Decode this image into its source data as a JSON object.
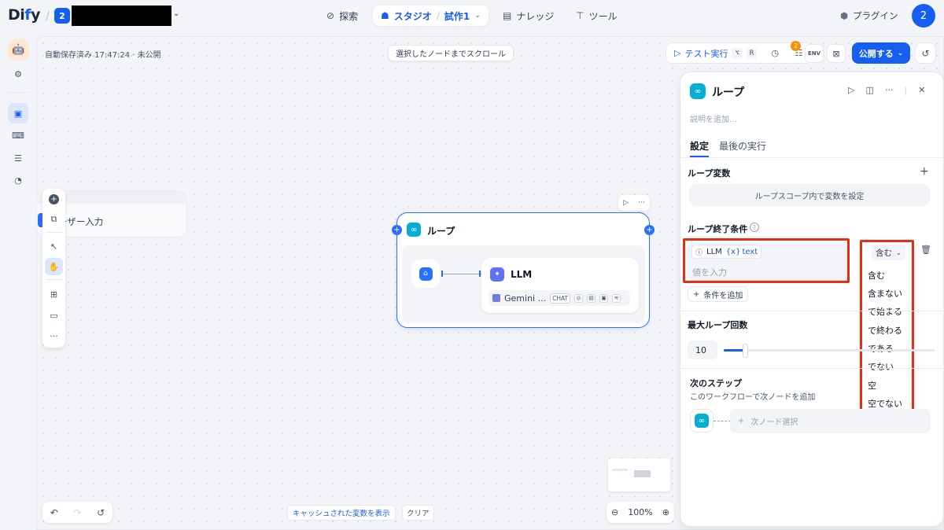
{
  "app": {
    "logo_main": "Di",
    "logo_dot": "f",
    "logo_end": "y",
    "workspace_badge": "2"
  },
  "nav": {
    "explore": "探索",
    "studio": "スタジオ",
    "app_name": "試作1",
    "knowledge": "ナレッジ",
    "tools": "ツール",
    "plugins": "プラグイン",
    "avatar": "2"
  },
  "canvas": {
    "autosave": "自動保存済み 17:47:24 · 未公開",
    "scroll_to_node": "選択したノードまでスクロール",
    "test_run": "テスト実行",
    "kbd_option": "⌥",
    "kbd_r": "R",
    "checklist_count": "2",
    "env_label": "ENV",
    "publish": "公開する",
    "start_node_label": "ーザー入力",
    "zoom": "100%",
    "show_cached": "キャッシュされた変数を表示",
    "clear": "クリア"
  },
  "loop_node": {
    "title": "ループ",
    "llm_title": "LLM",
    "model": "Gemini ...",
    "chip_chat": "CHAT"
  },
  "panel": {
    "title": "ループ",
    "description_placeholder": "説明を追加...",
    "tab_settings": "設定",
    "tab_last_run": "最後の実行",
    "loop_vars_title": "ループ変数",
    "loop_vars_hint": "ループスコープ内で変数を設定",
    "end_cond_title": "ループ終了条件",
    "cond_node": "LLM",
    "cond_var": "text",
    "cond_value_placeholder": "値を入力",
    "operator_selected": "含む",
    "operators": [
      "含む",
      "含まない",
      "で始まる",
      "で終わる",
      "である",
      "でない",
      "空",
      "空でない"
    ],
    "add_condition": "条件を追加",
    "max_loop_title": "最大ループ回数",
    "max_loop_value": "10",
    "next_step_title": "次のステップ",
    "next_step_desc": "このワークフローで次ノードを追加",
    "next_node_select": "次ノード選択"
  },
  "colors": {
    "accent": "#155eef",
    "loop_icon": "#06aed4",
    "llm_icon": "#6172f3",
    "highlight": "#e62e17",
    "badge": "#f79009"
  },
  "icons": [
    "explore-icon",
    "studio-robot-icon",
    "knowledge-icon",
    "tools-icon",
    "plugin-icon",
    "play-icon",
    "history-icon",
    "loop-icon",
    "trash-icon",
    "plus-icon",
    "chevron-down-icon"
  ]
}
